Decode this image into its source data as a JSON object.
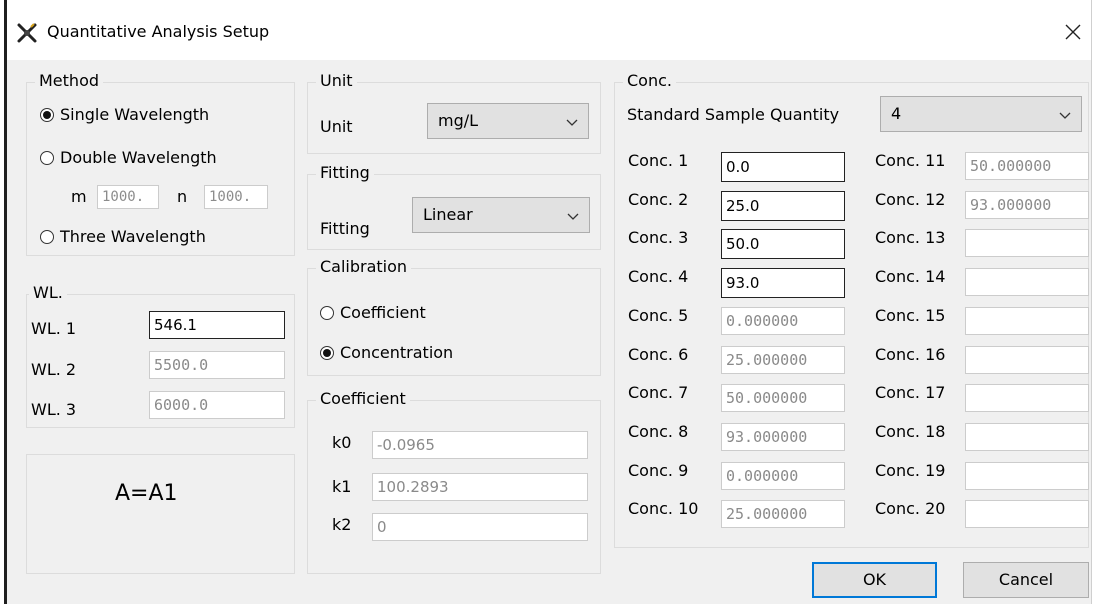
{
  "window": {
    "title": "Quantitative Analysis Setup"
  },
  "method": {
    "legend": "Method",
    "options": [
      "Single Wavelength",
      "Double Wavelength",
      "Three Wavelength"
    ],
    "selected": "Single Wavelength",
    "m_label": "m",
    "m_value": "1000.",
    "n_label": "n",
    "n_value": "1000."
  },
  "wl": {
    "legend": "WL.",
    "rows": [
      {
        "label": "WL. 1",
        "value": "546.1"
      },
      {
        "label": "WL. 2",
        "value": "5500.0"
      },
      {
        "label": "WL. 3",
        "value": "6000.0"
      }
    ]
  },
  "formula": "A=A1",
  "unit": {
    "legend": "Unit",
    "label": "Unit",
    "value": "mg/L"
  },
  "fitting": {
    "legend": "Fitting",
    "label": "Fitting",
    "value": "Linear"
  },
  "calibration": {
    "legend": "Calibration",
    "options": [
      "Coefficient",
      "Concentration"
    ],
    "selected": "Concentration"
  },
  "coefficient": {
    "legend": "Coefficient",
    "rows": [
      {
        "label": "k0",
        "value": "-0.0965"
      },
      {
        "label": "k1",
        "value": "100.2893"
      },
      {
        "label": "k2",
        "value": "0"
      }
    ]
  },
  "conc": {
    "legend": "Conc.",
    "std_label": "Standard Sample Quantity",
    "std_value": "4",
    "left": [
      {
        "label": "Conc. 1",
        "value": "0.0"
      },
      {
        "label": "Conc. 2",
        "value": "25.0"
      },
      {
        "label": "Conc. 3",
        "value": "50.0"
      },
      {
        "label": "Conc. 4",
        "value": "93.0"
      },
      {
        "label": "Conc. 5",
        "value": "0.000000"
      },
      {
        "label": "Conc. 6",
        "value": "25.000000"
      },
      {
        "label": "Conc. 7",
        "value": "50.000000"
      },
      {
        "label": "Conc. 8",
        "value": "93.000000"
      },
      {
        "label": "Conc. 9",
        "value": "0.000000"
      },
      {
        "label": "Conc. 10",
        "value": "25.000000"
      }
    ],
    "right": [
      {
        "label": "Conc. 11",
        "value": "50.000000"
      },
      {
        "label": "Conc. 12",
        "value": "93.000000"
      },
      {
        "label": "Conc. 13",
        "value": ""
      },
      {
        "label": "Conc. 14",
        "value": ""
      },
      {
        "label": "Conc. 15",
        "value": ""
      },
      {
        "label": "Conc. 16",
        "value": ""
      },
      {
        "label": "Conc. 17",
        "value": ""
      },
      {
        "label": "Conc. 18",
        "value": ""
      },
      {
        "label": "Conc. 19",
        "value": ""
      },
      {
        "label": "Conc. 20",
        "value": ""
      }
    ]
  },
  "buttons": {
    "ok": "OK",
    "cancel": "Cancel"
  }
}
